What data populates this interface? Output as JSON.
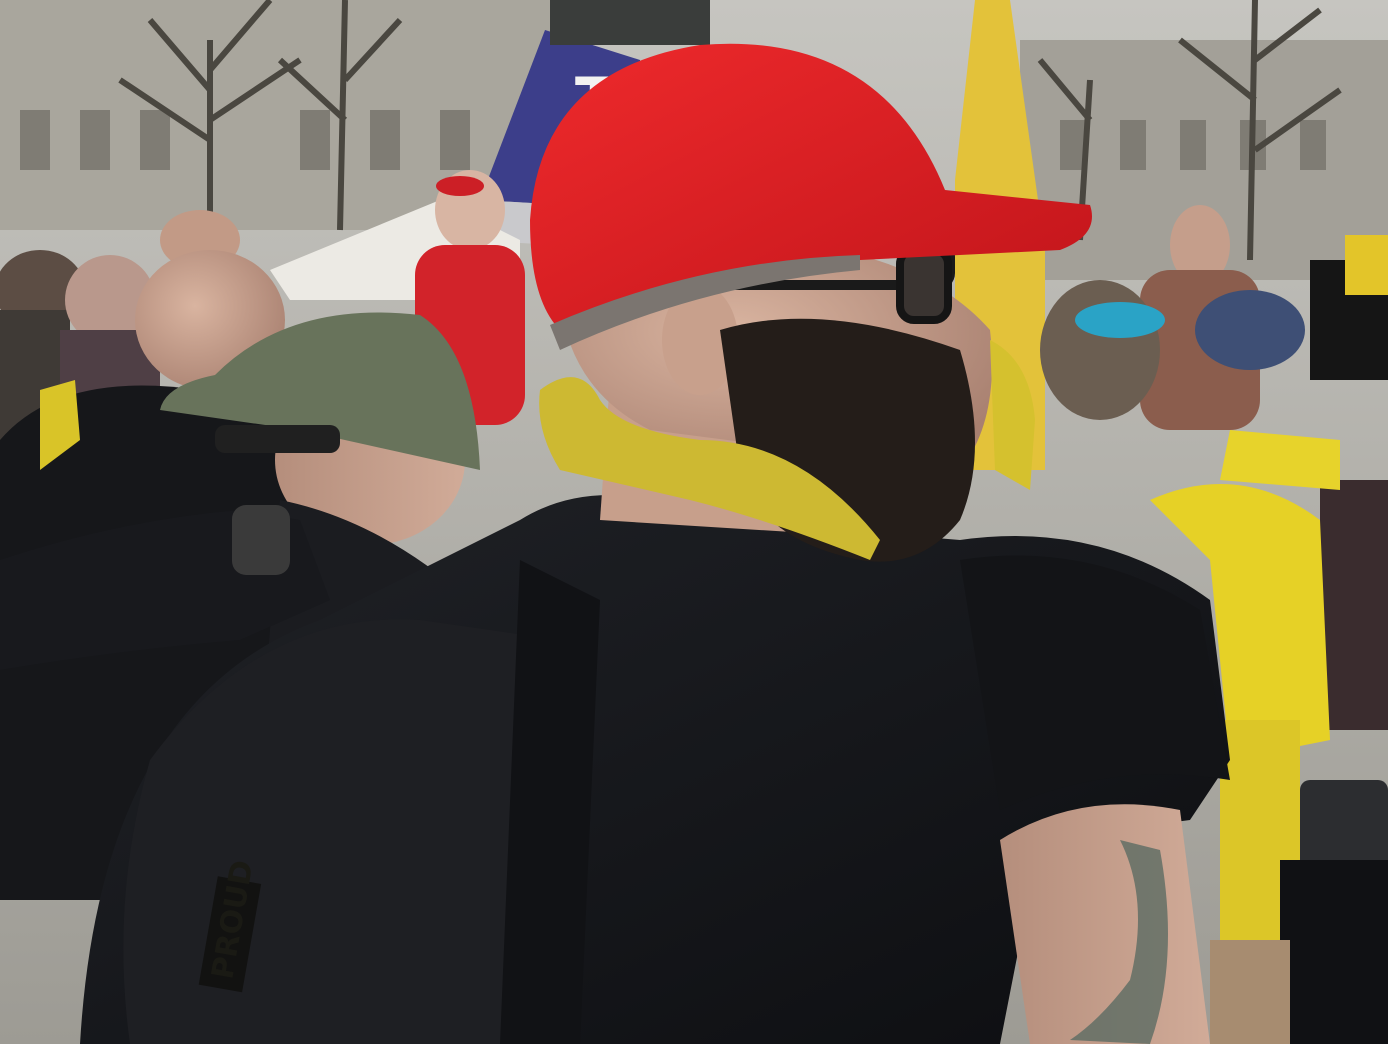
{
  "scene": {
    "flag_text": "T",
    "patch_text": "PROUD"
  },
  "colors": {
    "sky": "#b9b9b5",
    "building": "#a7a49b",
    "red_cap": "#e01d22",
    "green_cap": "#66705a",
    "yellow_scarf": "#c7b62e",
    "black_jacket": "#17181c",
    "yellow_flag": "#e9c63a"
  }
}
